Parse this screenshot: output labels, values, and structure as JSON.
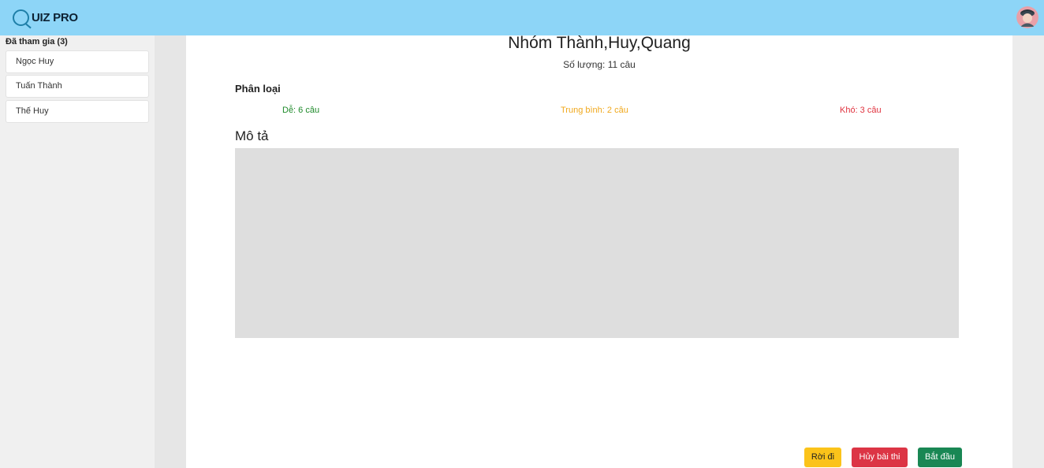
{
  "header": {
    "logo_text": "UIZ PRO",
    "logo_letter": "Q",
    "avatar_icon": "user-avatar"
  },
  "sidebar": {
    "title": "Đã tham gia (3)",
    "participants": [
      "Ngọc Huy",
      "Tuấn Thành",
      "Thế Huy"
    ]
  },
  "main": {
    "group_name": "Nhóm Thành,Huy,Quang",
    "question_count": "Số lượng: 11 câu",
    "category_title": "Phân loại",
    "categories": {
      "easy": "Dễ: 6 câu",
      "medium": "Trung bình: 2 câu",
      "hard": "Khó: 3 câu"
    },
    "description_title": "Mô tả",
    "description": ""
  },
  "actions": {
    "leave": "Rời đi",
    "cancel": "Hủy bài thi",
    "start": "Bắt đầu"
  },
  "colors": {
    "topbar": "#8dd5f7",
    "easy": "#1e8a2a",
    "medium": "#f0a81c",
    "hard": "#e0333f",
    "leave_button": "#fbc31a",
    "cancel_button": "#dc3545",
    "start_button": "#198754"
  }
}
